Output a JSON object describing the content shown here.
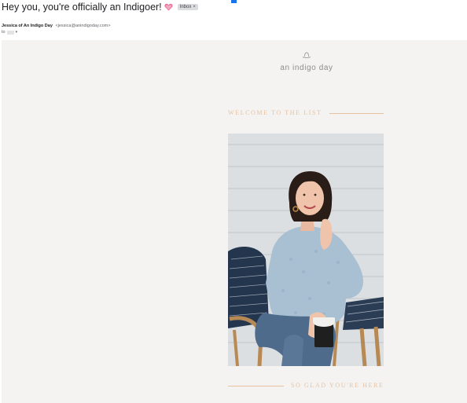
{
  "email": {
    "subject": "Hey you, you're officially an Indigoer!",
    "subject_icon": "heart-emoji-icon",
    "label_chip": "Inbox",
    "label_chip_close": "×",
    "sender_name": "Jessica of An Indigo Day",
    "sender_email": "<jessica@anindigoday.com>",
    "to_prefix": "to",
    "expand_icon": "chevron-down-icon"
  },
  "newsletter": {
    "brand": "an indigo day",
    "logo_icon": "hat-icon",
    "welcome_heading": "WELCOME TO THE LIST",
    "closing_heading": "SO GLAD YOU'RE HERE",
    "accent_color": "#e7c2a0",
    "background_color": "#f4f3f2"
  }
}
